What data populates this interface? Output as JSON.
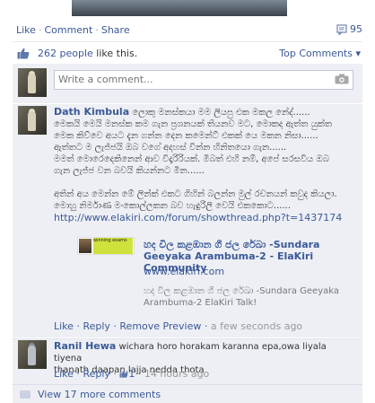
{
  "actions": {
    "like": "Like",
    "comment": "Comment",
    "share": "Share",
    "comment_count": "95"
  },
  "likes": {
    "link": "262 people",
    "suffix": " like this.",
    "sort_label": "Top Comments"
  },
  "composer": {
    "placeholder": "Write a comment..."
  },
  "comment1": {
    "author": "Dath Kimbula",
    "text_lines": [
      "ලොකු මනස්කයා මම ලියපු එක මකල නේද්......",
      "මෙකයි මෙයි මනස්ක කම ගැන ප්‍රශනයක් තියනව මට, මොකද ඇත්ත යුක්ත",
      "මෙක කිව්වෙ අයට දැන ගන්න දෙන කමෙන්ට් එකක් යෙ මකන නිසා......",
      "ඇත්තට ම ලැජ්ජයි ඔබ වගේ අදහස් වින්න හිනිතයො ගැන......",
      "මමත් මොරෙදෙකිනෙන් ආව විදෑරිරියක්. මිබත් එහි නම්, අපේ සරසවිය ඔබ",
      "ගැන ලැජ්ජ වන බවයි කියන්නට මින......"
    ],
    "text_lines2": [
      "අතින් අය මෙන්න මේ ලින්ක් එකට ගිහින් බලන්න මුල් රචනයන් කවුද කියලා.",
      "මොහු නිර්මාණ මංකොල්ලකන බව හැඳුරිලි වෙයි එකකොට......"
    ],
    "url": "http://www.elakiri.com/forum/showthread.php?t=1437174",
    "attachment": {
      "thumb_text": "winning exams",
      "title": "හද විල කළඹාන ගී ජල රේඛා -Sundara Geeyaka Arambuma-2 - ElaKiri Community",
      "site": "www.elakiri.com",
      "description": "හද විල කළඹාන ගී ජල රේඛා -Sundara Geeyaka Arambuma-2 ElaKiri Talk!"
    },
    "actions": {
      "like": "Like",
      "reply": "Reply",
      "remove_preview": "Remove Preview",
      "time": "a few seconds ago"
    }
  },
  "comment2": {
    "author": "Ranil Hewa",
    "text_inline": "wichara horo horakam karanna epa,owa liyala tiyena",
    "text_line2": "thanath daapan,lajja nedda thota",
    "actions": {
      "like": "Like",
      "reply": "Reply",
      "likes": "1",
      "time": "14 hours ago"
    }
  },
  "view_more": "View 17 more comments",
  "colors": {
    "link": "#3b5998",
    "panel": "#edeff4"
  }
}
